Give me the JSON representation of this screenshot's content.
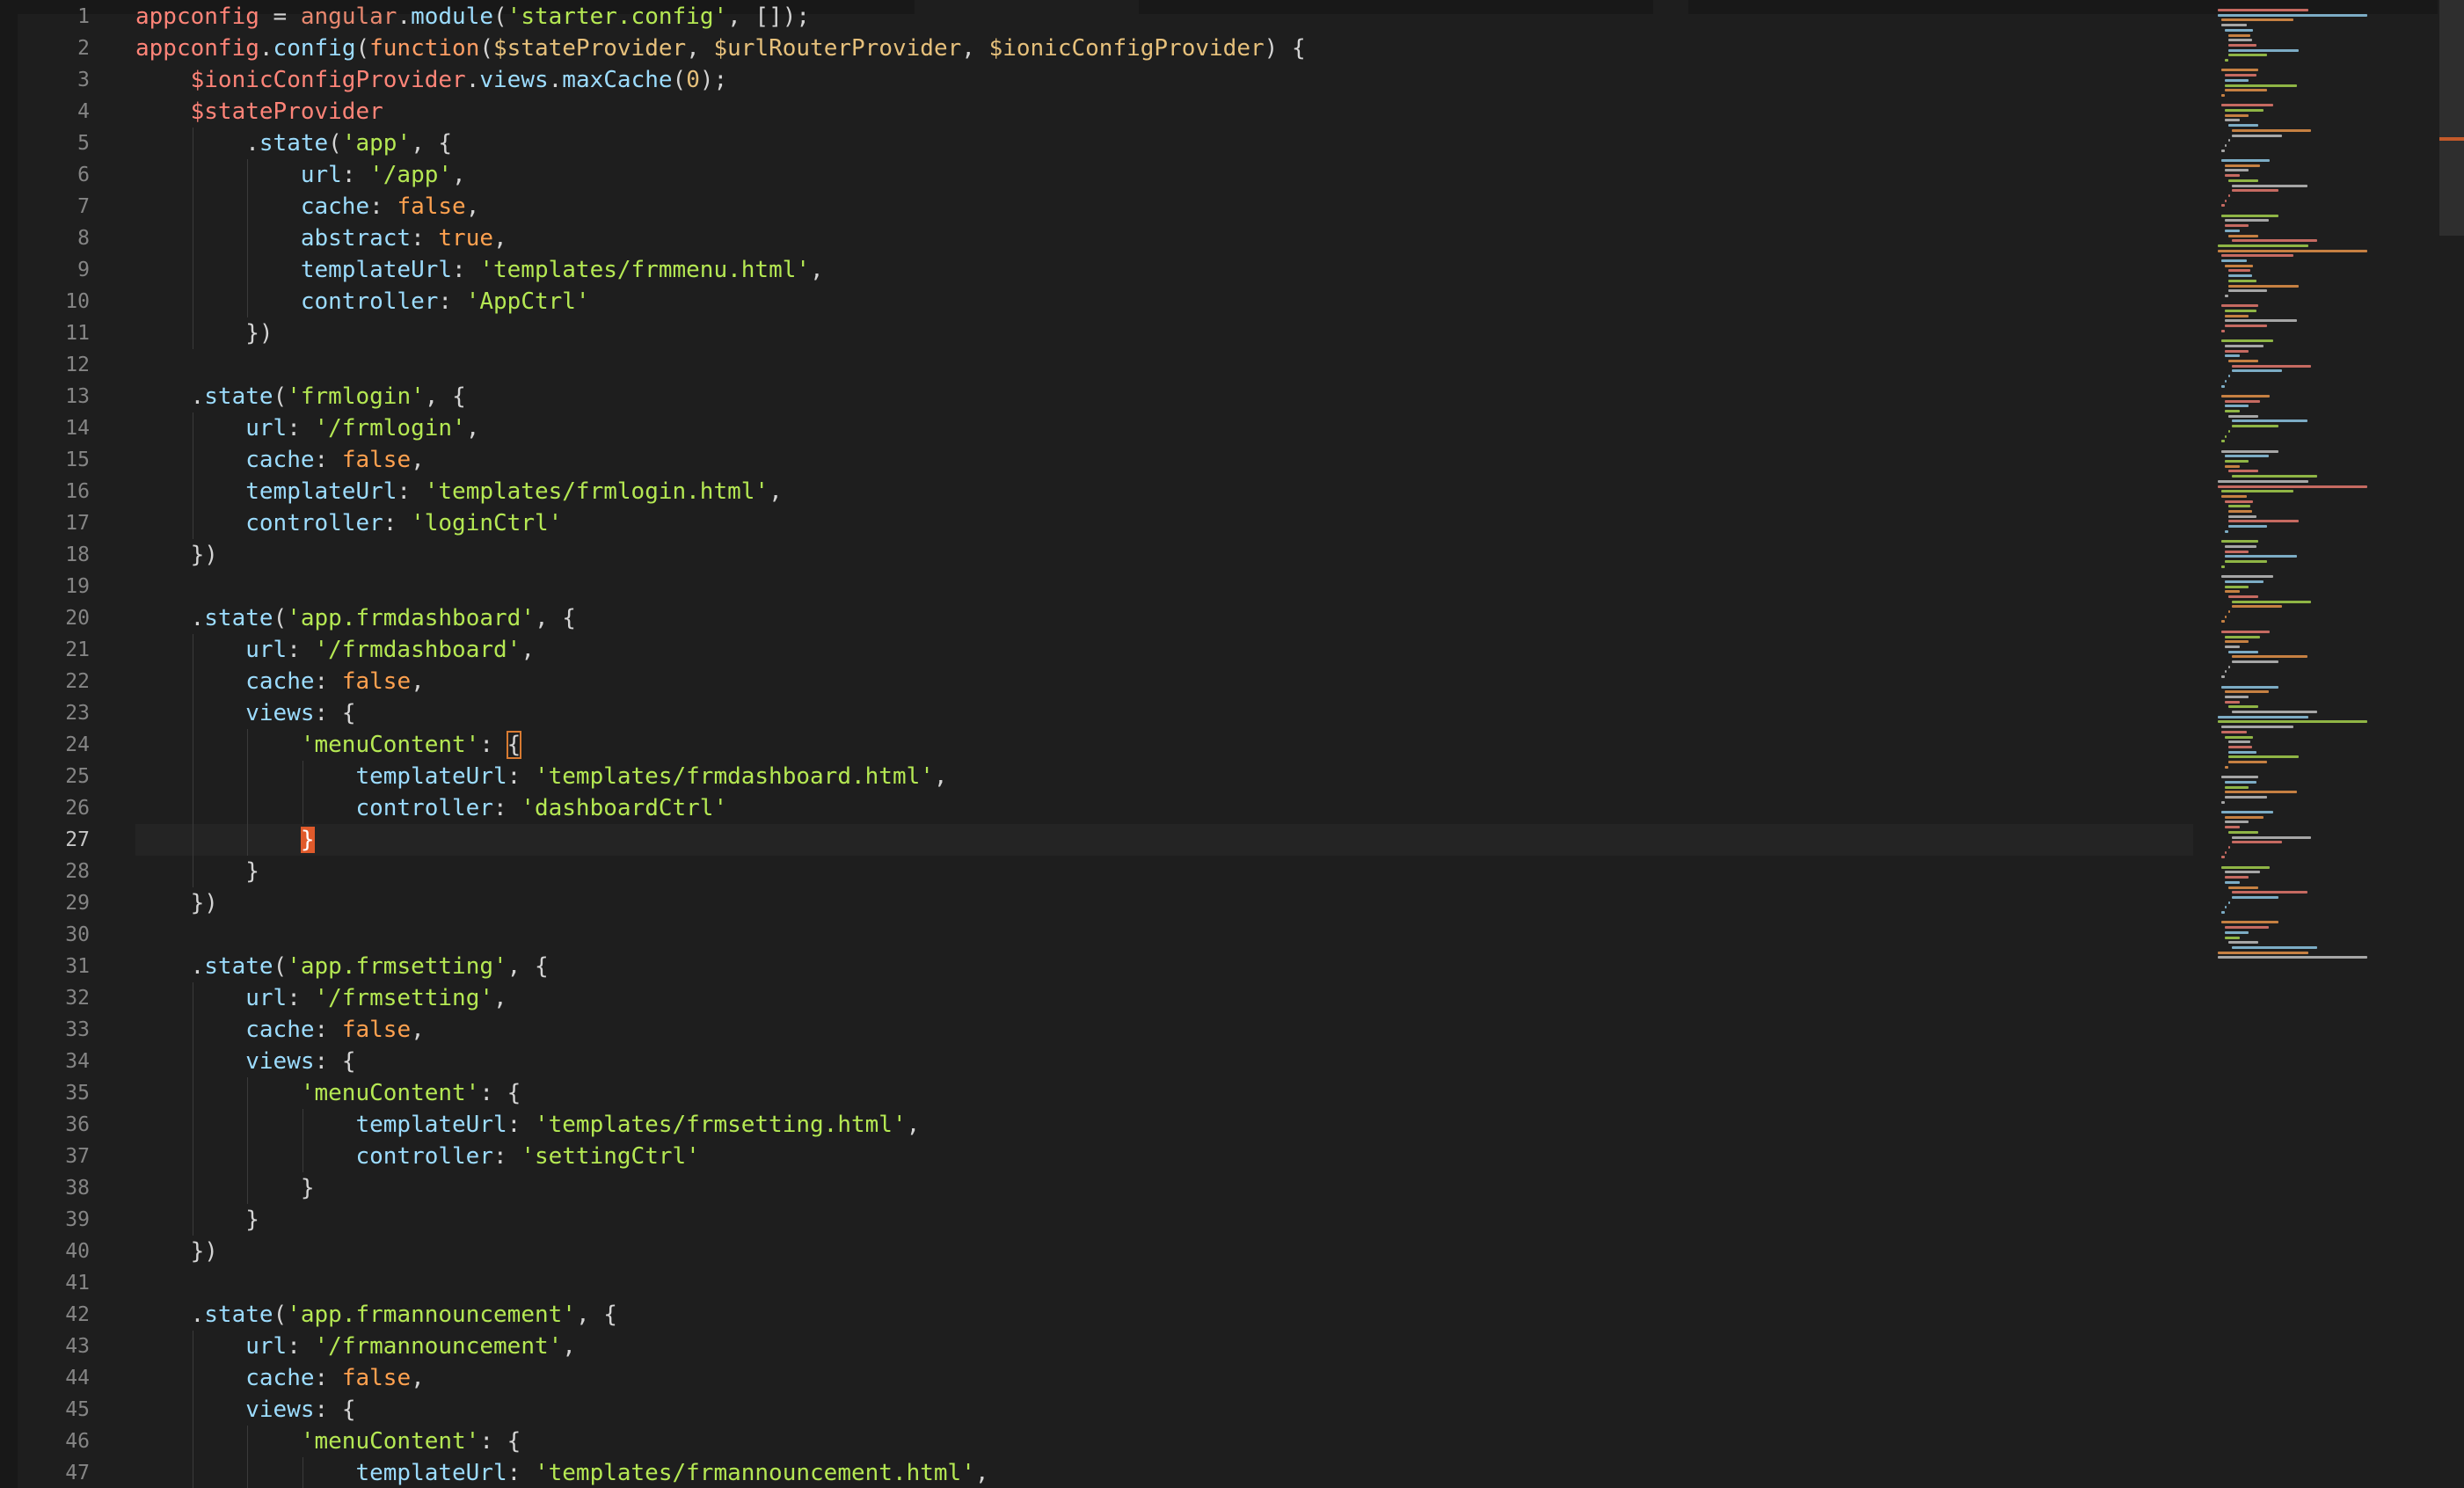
{
  "editor": {
    "language": "javascript",
    "active_line": 27,
    "lines": [
      {
        "n": "1",
        "indent": 0,
        "tokens": [
          [
            "var",
            "appconfig"
          ],
          [
            "punc",
            " = "
          ],
          [
            "ang",
            "angular"
          ],
          [
            "punc",
            "."
          ],
          [
            "mem",
            "module"
          ],
          [
            "punc",
            "("
          ],
          [
            "str",
            "'starter.config'"
          ],
          [
            "punc",
            ", []);"
          ]
        ]
      },
      {
        "n": "2",
        "indent": 0,
        "tokens": [
          [
            "var",
            "appconfig"
          ],
          [
            "punc",
            "."
          ],
          [
            "mem",
            "config"
          ],
          [
            "punc",
            "("
          ],
          [
            "kw",
            "function"
          ],
          [
            "punc",
            "("
          ],
          [
            "param",
            "$stateProvider"
          ],
          [
            "punc",
            ", "
          ],
          [
            "param",
            "$urlRouterProvider"
          ],
          [
            "punc",
            ", "
          ],
          [
            "param",
            "$ionicConfigProvider"
          ],
          [
            "punc",
            ") {"
          ]
        ]
      },
      {
        "n": "3",
        "indent": 1,
        "tokens": [
          [
            "var",
            "$ionicConfigProvider"
          ],
          [
            "punc",
            "."
          ],
          [
            "mem",
            "views"
          ],
          [
            "punc",
            "."
          ],
          [
            "mem",
            "maxCache"
          ],
          [
            "punc",
            "("
          ],
          [
            "num",
            "0"
          ],
          [
            "punc",
            ");"
          ]
        ]
      },
      {
        "n": "4",
        "indent": 1,
        "tokens": [
          [
            "var",
            "$stateProvider"
          ]
        ]
      },
      {
        "n": "5",
        "indent": 2,
        "tokens": [
          [
            "punc",
            "."
          ],
          [
            "mem",
            "state"
          ],
          [
            "punc",
            "("
          ],
          [
            "str",
            "'app'"
          ],
          [
            "punc",
            ", {"
          ]
        ]
      },
      {
        "n": "6",
        "indent": 3,
        "tokens": [
          [
            "prop",
            "url"
          ],
          [
            "punc",
            ": "
          ],
          [
            "str",
            "'/app'"
          ],
          [
            "punc",
            ","
          ]
        ]
      },
      {
        "n": "7",
        "indent": 3,
        "tokens": [
          [
            "prop",
            "cache"
          ],
          [
            "punc",
            ": "
          ],
          [
            "bool",
            "false"
          ],
          [
            "punc",
            ","
          ]
        ]
      },
      {
        "n": "8",
        "indent": 3,
        "tokens": [
          [
            "prop",
            "abstract"
          ],
          [
            "punc",
            ": "
          ],
          [
            "bool",
            "true"
          ],
          [
            "punc",
            ","
          ]
        ]
      },
      {
        "n": "9",
        "indent": 3,
        "tokens": [
          [
            "prop",
            "templateUrl"
          ],
          [
            "punc",
            ": "
          ],
          [
            "str",
            "'templates/frmmenu.html'"
          ],
          [
            "punc",
            ","
          ]
        ]
      },
      {
        "n": "10",
        "indent": 3,
        "tokens": [
          [
            "prop",
            "controller"
          ],
          [
            "punc",
            ": "
          ],
          [
            "str",
            "'AppCtrl'"
          ]
        ]
      },
      {
        "n": "11",
        "indent": 2,
        "tokens": [
          [
            "punc",
            "})"
          ]
        ]
      },
      {
        "n": "12",
        "indent": 0,
        "tokens": []
      },
      {
        "n": "13",
        "indent": 1,
        "tokens": [
          [
            "punc",
            "."
          ],
          [
            "mem",
            "state"
          ],
          [
            "punc",
            "("
          ],
          [
            "str",
            "'frmlogin'"
          ],
          [
            "punc",
            ", {"
          ]
        ]
      },
      {
        "n": "14",
        "indent": 2,
        "tokens": [
          [
            "prop",
            "url"
          ],
          [
            "punc",
            ": "
          ],
          [
            "str",
            "'/frmlogin'"
          ],
          [
            "punc",
            ","
          ]
        ]
      },
      {
        "n": "15",
        "indent": 2,
        "tokens": [
          [
            "prop",
            "cache"
          ],
          [
            "punc",
            ": "
          ],
          [
            "bool",
            "false"
          ],
          [
            "punc",
            ","
          ]
        ]
      },
      {
        "n": "16",
        "indent": 2,
        "tokens": [
          [
            "prop",
            "templateUrl"
          ],
          [
            "punc",
            ": "
          ],
          [
            "str",
            "'templates/frmlogin.html'"
          ],
          [
            "punc",
            ","
          ]
        ]
      },
      {
        "n": "17",
        "indent": 2,
        "tokens": [
          [
            "prop",
            "controller"
          ],
          [
            "punc",
            ": "
          ],
          [
            "str",
            "'loginCtrl'"
          ]
        ]
      },
      {
        "n": "18",
        "indent": 1,
        "tokens": [
          [
            "punc",
            "})"
          ]
        ]
      },
      {
        "n": "19",
        "indent": 0,
        "tokens": []
      },
      {
        "n": "20",
        "indent": 1,
        "tokens": [
          [
            "punc",
            "."
          ],
          [
            "mem",
            "state"
          ],
          [
            "punc",
            "("
          ],
          [
            "str",
            "'app.frmdashboard'"
          ],
          [
            "punc",
            ", {"
          ]
        ]
      },
      {
        "n": "21",
        "indent": 2,
        "tokens": [
          [
            "prop",
            "url"
          ],
          [
            "punc",
            ": "
          ],
          [
            "str",
            "'/frmdashboard'"
          ],
          [
            "punc",
            ","
          ]
        ]
      },
      {
        "n": "22",
        "indent": 2,
        "tokens": [
          [
            "prop",
            "cache"
          ],
          [
            "punc",
            ": "
          ],
          [
            "bool",
            "false"
          ],
          [
            "punc",
            ","
          ]
        ]
      },
      {
        "n": "23",
        "indent": 2,
        "tokens": [
          [
            "prop",
            "views"
          ],
          [
            "punc",
            ": {"
          ]
        ]
      },
      {
        "n": "24",
        "indent": 3,
        "tokens": [
          [
            "str",
            "'menuContent'"
          ],
          [
            "punc",
            ": "
          ],
          [
            "bracket",
            "{"
          ]
        ]
      },
      {
        "n": "25",
        "indent": 4,
        "tokens": [
          [
            "prop",
            "templateUrl"
          ],
          [
            "punc",
            ": "
          ],
          [
            "str",
            "'templates/frmdashboard.html'"
          ],
          [
            "punc",
            ","
          ]
        ]
      },
      {
        "n": "26",
        "indent": 4,
        "tokens": [
          [
            "prop",
            "controller"
          ],
          [
            "punc",
            ": "
          ],
          [
            "str",
            "'dashboardCtrl'"
          ]
        ]
      },
      {
        "n": "27",
        "indent": 3,
        "tokens": [
          [
            "cursor",
            "}"
          ]
        ]
      },
      {
        "n": "28",
        "indent": 2,
        "tokens": [
          [
            "punc",
            "}"
          ]
        ]
      },
      {
        "n": "29",
        "indent": 1,
        "tokens": [
          [
            "punc",
            "})"
          ]
        ]
      },
      {
        "n": "30",
        "indent": 0,
        "tokens": []
      },
      {
        "n": "31",
        "indent": 1,
        "tokens": [
          [
            "punc",
            "."
          ],
          [
            "mem",
            "state"
          ],
          [
            "punc",
            "("
          ],
          [
            "str",
            "'app.frmsetting'"
          ],
          [
            "punc",
            ", {"
          ]
        ]
      },
      {
        "n": "32",
        "indent": 2,
        "tokens": [
          [
            "prop",
            "url"
          ],
          [
            "punc",
            ": "
          ],
          [
            "str",
            "'/frmsetting'"
          ],
          [
            "punc",
            ","
          ]
        ]
      },
      {
        "n": "33",
        "indent": 2,
        "tokens": [
          [
            "prop",
            "cache"
          ],
          [
            "punc",
            ": "
          ],
          [
            "bool",
            "false"
          ],
          [
            "punc",
            ","
          ]
        ]
      },
      {
        "n": "34",
        "indent": 2,
        "tokens": [
          [
            "prop",
            "views"
          ],
          [
            "punc",
            ": {"
          ]
        ]
      },
      {
        "n": "35",
        "indent": 3,
        "tokens": [
          [
            "str",
            "'menuContent'"
          ],
          [
            "punc",
            ": {"
          ]
        ]
      },
      {
        "n": "36",
        "indent": 4,
        "tokens": [
          [
            "prop",
            "templateUrl"
          ],
          [
            "punc",
            ": "
          ],
          [
            "str",
            "'templates/frmsetting.html'"
          ],
          [
            "punc",
            ","
          ]
        ]
      },
      {
        "n": "37",
        "indent": 4,
        "tokens": [
          [
            "prop",
            "controller"
          ],
          [
            "punc",
            ": "
          ],
          [
            "str",
            "'settingCtrl'"
          ]
        ]
      },
      {
        "n": "38",
        "indent": 3,
        "tokens": [
          [
            "punc",
            "}"
          ]
        ]
      },
      {
        "n": "39",
        "indent": 2,
        "tokens": [
          [
            "punc",
            "}"
          ]
        ]
      },
      {
        "n": "40",
        "indent": 1,
        "tokens": [
          [
            "punc",
            "})"
          ]
        ]
      },
      {
        "n": "41",
        "indent": 0,
        "tokens": []
      },
      {
        "n": "42",
        "indent": 1,
        "tokens": [
          [
            "punc",
            "."
          ],
          [
            "mem",
            "state"
          ],
          [
            "punc",
            "("
          ],
          [
            "str",
            "'app.frmannouncement'"
          ],
          [
            "punc",
            ", {"
          ]
        ]
      },
      {
        "n": "43",
        "indent": 2,
        "tokens": [
          [
            "prop",
            "url"
          ],
          [
            "punc",
            ": "
          ],
          [
            "str",
            "'/frmannouncement'"
          ],
          [
            "punc",
            ","
          ]
        ]
      },
      {
        "n": "44",
        "indent": 2,
        "tokens": [
          [
            "prop",
            "cache"
          ],
          [
            "punc",
            ": "
          ],
          [
            "bool",
            "false"
          ],
          [
            "punc",
            ","
          ]
        ]
      },
      {
        "n": "45",
        "indent": 2,
        "tokens": [
          [
            "prop",
            "views"
          ],
          [
            "punc",
            ": {"
          ]
        ]
      },
      {
        "n": "46",
        "indent": 3,
        "tokens": [
          [
            "str",
            "'menuContent'"
          ],
          [
            "punc",
            ": {"
          ]
        ]
      },
      {
        "n": "47",
        "indent": 4,
        "tokens": [
          [
            "prop",
            "templateUrl"
          ],
          [
            "punc",
            ": "
          ],
          [
            "str",
            "'templates/frmannouncement.html'"
          ],
          [
            "punc",
            ","
          ]
        ]
      }
    ]
  },
  "colors": {
    "background": "#1e1e1e",
    "string": "#b5e853",
    "keyword": "#ff9e64",
    "variable": "#ff8478",
    "property": "#9cdcfe",
    "bracket_highlight": "#e05a2b"
  }
}
